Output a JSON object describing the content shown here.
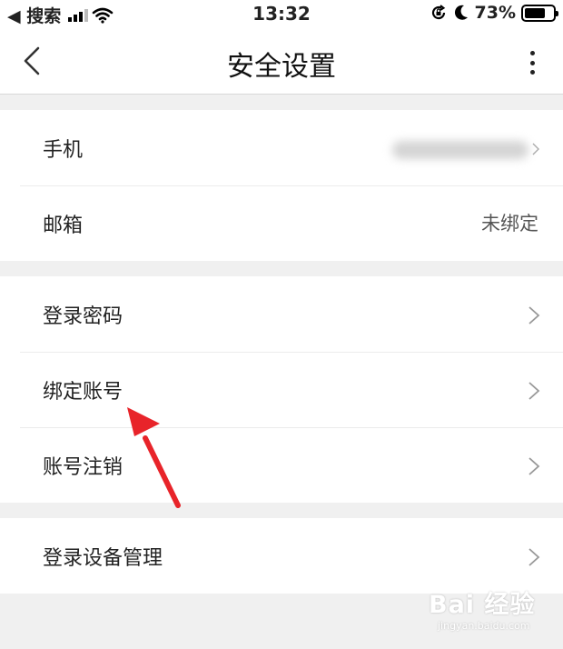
{
  "status_bar": {
    "back_app": "◀ 搜索",
    "time": "13:32",
    "battery": "73%",
    "battery_level": 0.73
  },
  "nav": {
    "title": "安全设置",
    "back_icon": "chevron-left-icon",
    "more_icon": "more-vertical-icon"
  },
  "groups": [
    {
      "items": [
        {
          "label": "手机",
          "value": ""
        },
        {
          "label": "邮箱",
          "value": "未绑定"
        }
      ]
    },
    {
      "items": [
        {
          "label": "登录密码"
        },
        {
          "label": "绑定账号"
        },
        {
          "label": "账号注销"
        }
      ]
    },
    {
      "items": [
        {
          "label": "登录设备管理"
        }
      ]
    }
  ],
  "watermark": {
    "main": "Bai 经验",
    "sub": "jingyan.baidu.com"
  },
  "colors": {
    "annotation_arrow": "#e8242a",
    "background": "#f0f0f0"
  }
}
